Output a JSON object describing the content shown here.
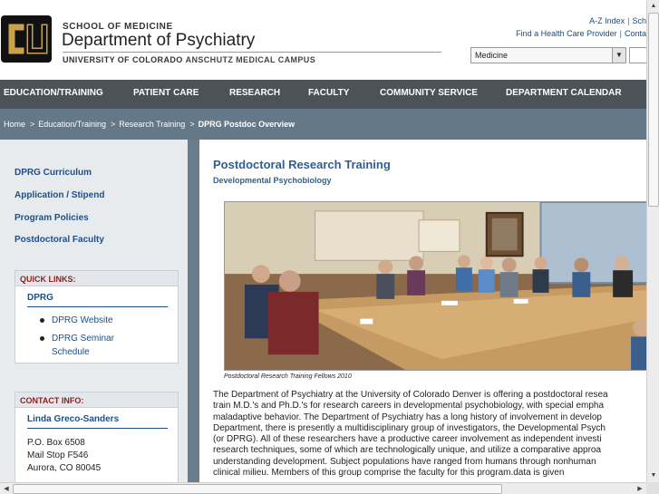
{
  "header": {
    "school": "SCHOOL OF MEDICINE",
    "department": "Department of Psychiatry",
    "campus_a": "UNIVERSITY OF COLORADO",
    "campus_b": "ANSCHUTZ MEDICAL CAMPUS",
    "util_links": {
      "az_index": "A-Z Index",
      "az_sep": "|",
      "sch": "Sch",
      "find_provider": "Find a Health Care Provider",
      "prov_sep": "|",
      "contact": "Conta"
    },
    "scope_select": {
      "selected": "Medicine"
    }
  },
  "nav": {
    "items": [
      "EDUCATION/TRAINING",
      "PATIENT CARE",
      "RESEARCH",
      "FACULTY",
      "COMMUNITY SERVICE",
      "DEPARTMENT CALENDAR"
    ]
  },
  "breadcrumb": {
    "items": [
      "Home",
      "Education/Training",
      "Research Training"
    ],
    "current": "DPRG Postdoc Overview",
    "separator": ">"
  },
  "sidebar": {
    "links": [
      "DPRG Curriculum",
      "Application / Stipend",
      "Program Policies",
      "Postdoctoral Faculty"
    ],
    "quick_links": {
      "heading": "QUICK LINKS:",
      "sub": "DPRG",
      "items": [
        "DPRG Website",
        "DPRG Seminar Schedule"
      ]
    },
    "contact": {
      "heading": "CONTACT INFO:",
      "name": "Linda Greco-Sanders",
      "address": [
        "P.O. Box 6508",
        "Mail Stop F546",
        "Aurora, CO 80045"
      ]
    }
  },
  "main": {
    "title": "Postdoctoral Research Training",
    "subtitle": "Developmental Psychobiology",
    "caption": "Postdoctoral Research Training Fellows 2010",
    "body_lines": [
      "The Department of Psychiatry at the University of Colorado Denver is offering a postdoctoral resea",
      "train M.D.'s and Ph.D.'s for research careers in developmental psychobiology, with special empha",
      "maladaptive behavior. The Department of Psychiatry has a long history of involvement in develop",
      "Department, there is presently a multidisciplinary group of investigators, the Developmental Psych",
      "(or DPRG). All of these researchers have a productive career involvement as independent investi",
      "research techniques, some of which are technologically unique, and utilize a comparative approa",
      "understanding development. Subject populations have ranged from humans through nonhuman",
      "clinical milieu. Members of this group comprise the faculty for this program.data is given"
    ]
  },
  "colors": {
    "nav_bg": "#4b5258",
    "breadcrumb_bg": "#657887",
    "link_blue": "#1f4f86",
    "heading_red": "#8a1f1f",
    "title_blue": "#2f5f8f",
    "logo_gold": "#c9a24a"
  },
  "icons": {
    "logo": "cu-logo",
    "dropdown": "chevron-down-icon",
    "scroll_up": "arrow-up-icon",
    "scroll_down": "arrow-down-icon",
    "scroll_left": "arrow-left-icon",
    "scroll_right": "arrow-right-icon"
  }
}
